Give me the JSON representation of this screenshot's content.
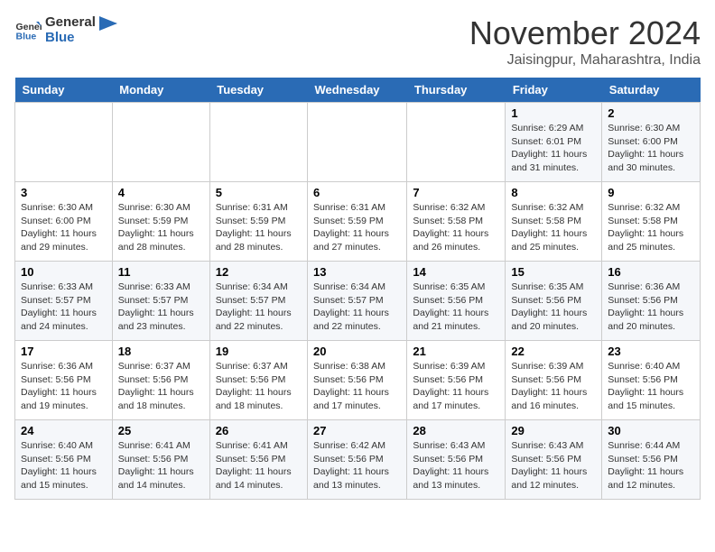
{
  "header": {
    "logo_line1": "General",
    "logo_line2": "Blue",
    "month": "November 2024",
    "location": "Jaisingpur, Maharashtra, India"
  },
  "weekdays": [
    "Sunday",
    "Monday",
    "Tuesday",
    "Wednesday",
    "Thursday",
    "Friday",
    "Saturday"
  ],
  "weeks": [
    [
      {
        "day": "",
        "sunrise": "",
        "sunset": "",
        "daylight": ""
      },
      {
        "day": "",
        "sunrise": "",
        "sunset": "",
        "daylight": ""
      },
      {
        "day": "",
        "sunrise": "",
        "sunset": "",
        "daylight": ""
      },
      {
        "day": "",
        "sunrise": "",
        "sunset": "",
        "daylight": ""
      },
      {
        "day": "",
        "sunrise": "",
        "sunset": "",
        "daylight": ""
      },
      {
        "day": "1",
        "sunrise": "Sunrise: 6:29 AM",
        "sunset": "Sunset: 6:01 PM",
        "daylight": "Daylight: 11 hours and 31 minutes."
      },
      {
        "day": "2",
        "sunrise": "Sunrise: 6:30 AM",
        "sunset": "Sunset: 6:00 PM",
        "daylight": "Daylight: 11 hours and 30 minutes."
      }
    ],
    [
      {
        "day": "3",
        "sunrise": "Sunrise: 6:30 AM",
        "sunset": "Sunset: 6:00 PM",
        "daylight": "Daylight: 11 hours and 29 minutes."
      },
      {
        "day": "4",
        "sunrise": "Sunrise: 6:30 AM",
        "sunset": "Sunset: 5:59 PM",
        "daylight": "Daylight: 11 hours and 28 minutes."
      },
      {
        "day": "5",
        "sunrise": "Sunrise: 6:31 AM",
        "sunset": "Sunset: 5:59 PM",
        "daylight": "Daylight: 11 hours and 28 minutes."
      },
      {
        "day": "6",
        "sunrise": "Sunrise: 6:31 AM",
        "sunset": "Sunset: 5:59 PM",
        "daylight": "Daylight: 11 hours and 27 minutes."
      },
      {
        "day": "7",
        "sunrise": "Sunrise: 6:32 AM",
        "sunset": "Sunset: 5:58 PM",
        "daylight": "Daylight: 11 hours and 26 minutes."
      },
      {
        "day": "8",
        "sunrise": "Sunrise: 6:32 AM",
        "sunset": "Sunset: 5:58 PM",
        "daylight": "Daylight: 11 hours and 25 minutes."
      },
      {
        "day": "9",
        "sunrise": "Sunrise: 6:32 AM",
        "sunset": "Sunset: 5:58 PM",
        "daylight": "Daylight: 11 hours and 25 minutes."
      }
    ],
    [
      {
        "day": "10",
        "sunrise": "Sunrise: 6:33 AM",
        "sunset": "Sunset: 5:57 PM",
        "daylight": "Daylight: 11 hours and 24 minutes."
      },
      {
        "day": "11",
        "sunrise": "Sunrise: 6:33 AM",
        "sunset": "Sunset: 5:57 PM",
        "daylight": "Daylight: 11 hours and 23 minutes."
      },
      {
        "day": "12",
        "sunrise": "Sunrise: 6:34 AM",
        "sunset": "Sunset: 5:57 PM",
        "daylight": "Daylight: 11 hours and 22 minutes."
      },
      {
        "day": "13",
        "sunrise": "Sunrise: 6:34 AM",
        "sunset": "Sunset: 5:57 PM",
        "daylight": "Daylight: 11 hours and 22 minutes."
      },
      {
        "day": "14",
        "sunrise": "Sunrise: 6:35 AM",
        "sunset": "Sunset: 5:56 PM",
        "daylight": "Daylight: 11 hours and 21 minutes."
      },
      {
        "day": "15",
        "sunrise": "Sunrise: 6:35 AM",
        "sunset": "Sunset: 5:56 PM",
        "daylight": "Daylight: 11 hours and 20 minutes."
      },
      {
        "day": "16",
        "sunrise": "Sunrise: 6:36 AM",
        "sunset": "Sunset: 5:56 PM",
        "daylight": "Daylight: 11 hours and 20 minutes."
      }
    ],
    [
      {
        "day": "17",
        "sunrise": "Sunrise: 6:36 AM",
        "sunset": "Sunset: 5:56 PM",
        "daylight": "Daylight: 11 hours and 19 minutes."
      },
      {
        "day": "18",
        "sunrise": "Sunrise: 6:37 AM",
        "sunset": "Sunset: 5:56 PM",
        "daylight": "Daylight: 11 hours and 18 minutes."
      },
      {
        "day": "19",
        "sunrise": "Sunrise: 6:37 AM",
        "sunset": "Sunset: 5:56 PM",
        "daylight": "Daylight: 11 hours and 18 minutes."
      },
      {
        "day": "20",
        "sunrise": "Sunrise: 6:38 AM",
        "sunset": "Sunset: 5:56 PM",
        "daylight": "Daylight: 11 hours and 17 minutes."
      },
      {
        "day": "21",
        "sunrise": "Sunrise: 6:39 AM",
        "sunset": "Sunset: 5:56 PM",
        "daylight": "Daylight: 11 hours and 17 minutes."
      },
      {
        "day": "22",
        "sunrise": "Sunrise: 6:39 AM",
        "sunset": "Sunset: 5:56 PM",
        "daylight": "Daylight: 11 hours and 16 minutes."
      },
      {
        "day": "23",
        "sunrise": "Sunrise: 6:40 AM",
        "sunset": "Sunset: 5:56 PM",
        "daylight": "Daylight: 11 hours and 15 minutes."
      }
    ],
    [
      {
        "day": "24",
        "sunrise": "Sunrise: 6:40 AM",
        "sunset": "Sunset: 5:56 PM",
        "daylight": "Daylight: 11 hours and 15 minutes."
      },
      {
        "day": "25",
        "sunrise": "Sunrise: 6:41 AM",
        "sunset": "Sunset: 5:56 PM",
        "daylight": "Daylight: 11 hours and 14 minutes."
      },
      {
        "day": "26",
        "sunrise": "Sunrise: 6:41 AM",
        "sunset": "Sunset: 5:56 PM",
        "daylight": "Daylight: 11 hours and 14 minutes."
      },
      {
        "day": "27",
        "sunrise": "Sunrise: 6:42 AM",
        "sunset": "Sunset: 5:56 PM",
        "daylight": "Daylight: 11 hours and 13 minutes."
      },
      {
        "day": "28",
        "sunrise": "Sunrise: 6:43 AM",
        "sunset": "Sunset: 5:56 PM",
        "daylight": "Daylight: 11 hours and 13 minutes."
      },
      {
        "day": "29",
        "sunrise": "Sunrise: 6:43 AM",
        "sunset": "Sunset: 5:56 PM",
        "daylight": "Daylight: 11 hours and 12 minutes."
      },
      {
        "day": "30",
        "sunrise": "Sunrise: 6:44 AM",
        "sunset": "Sunset: 5:56 PM",
        "daylight": "Daylight: 11 hours and 12 minutes."
      }
    ]
  ]
}
